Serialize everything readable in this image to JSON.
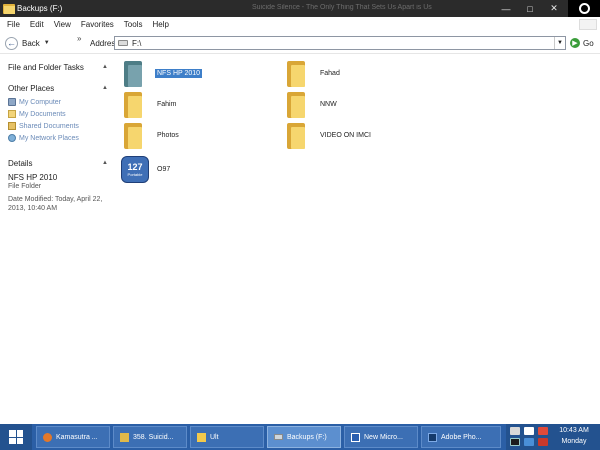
{
  "window": {
    "title": "Backups (F:)",
    "background_title": "Suicide Silence - The Only Thing That Sets Us Apart is Us",
    "minimize": "—",
    "maximize": "□",
    "close": "✕"
  },
  "menu": [
    "File",
    "Edit",
    "View",
    "Favorites",
    "Tools",
    "Help"
  ],
  "toolbar": {
    "back_label": "Back",
    "chevrons": "»",
    "address_label": "Address",
    "address_value": "F:\\",
    "go_label": "Go"
  },
  "taskpane": {
    "file_tasks_header": "File and Folder Tasks",
    "other_places_header": "Other Places",
    "other_places": [
      "My Computer",
      "My Documents",
      "Shared Documents",
      "My Network Places"
    ],
    "details_header": "Details",
    "details": {
      "name": "NFS HP 2010",
      "type": "File Folder",
      "modified": "Date Modified: Today, April 22, 2013, 10:40 AM"
    }
  },
  "files": [
    {
      "name": "NFS HP 2010",
      "icon": "folder-teal-icon",
      "selected": true
    },
    {
      "name": "Fahad",
      "icon": "folder-icon",
      "selected": false
    },
    {
      "name": "Fahim",
      "icon": "folder-icon",
      "selected": false
    },
    {
      "name": "NNW",
      "icon": "folder-icon",
      "selected": false
    },
    {
      "name": "Photos",
      "icon": "folder-icon",
      "selected": false
    },
    {
      "name": "VIDEO ON IMCI",
      "icon": "folder-icon",
      "selected": false
    },
    {
      "name": "O97",
      "icon": "portable-127-icon",
      "selected": false,
      "icon_text": "127",
      "icon_subtext": "Portable"
    }
  ],
  "taskbar": {
    "buttons": [
      {
        "label": "Kamasutra ...",
        "icon": "firefox-icon",
        "active": false
      },
      {
        "label": "358. Suicid...",
        "icon": "folder-icon",
        "active": false
      },
      {
        "label": "Ult",
        "icon": "folder-icon",
        "active": false
      },
      {
        "label": "Backups (F:)",
        "icon": "drive-icon",
        "active": true
      },
      {
        "label": "New Micro...",
        "icon": "word-icon",
        "active": false
      },
      {
        "label": "Adobe Pho...",
        "icon": "photoshop-icon",
        "active": false
      }
    ],
    "time": "10:43 AM",
    "day": "Monday"
  },
  "colors": {
    "titlebar": "#2b2b2b",
    "taskbar": "#2b5fa6",
    "selection": "#3e7fc9",
    "link": "#6b8bb8"
  }
}
